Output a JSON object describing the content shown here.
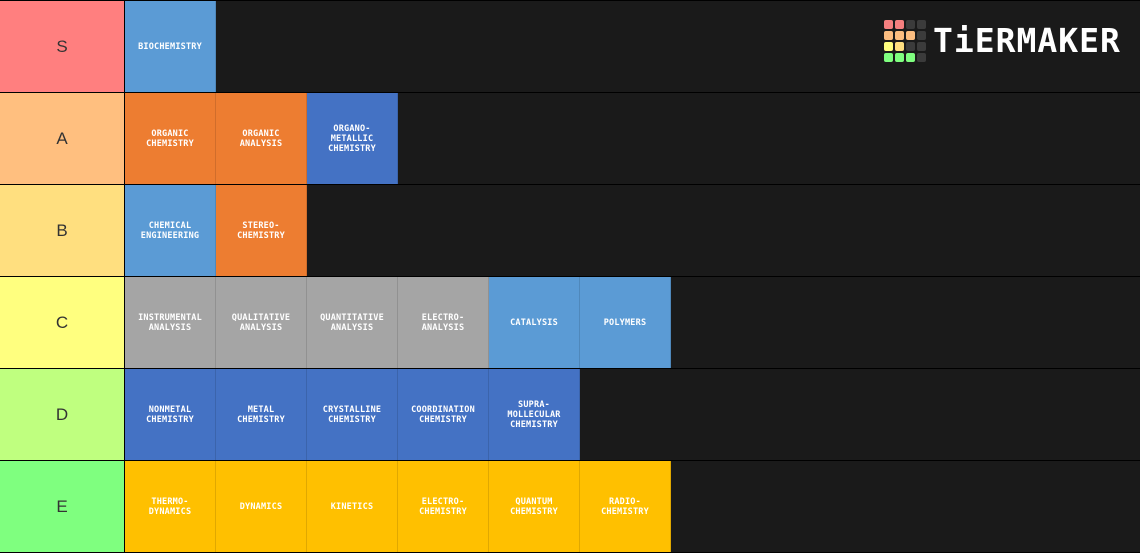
{
  "logo": {
    "text": "TiERMAKER",
    "grid_colors": [
      "#f57f7f",
      "#f57f7f",
      "#3b3b3b",
      "#3b3b3b",
      "#fbbd80",
      "#fbbd80",
      "#fbbd80",
      "#3b3b3b",
      "#ffff7f",
      "#ffdf80",
      "#3b3b3b",
      "#3b3b3b",
      "#7fff7f",
      "#7fff7f",
      "#7fff7f",
      "#3b3b3b"
    ]
  },
  "colors": {
    "light_blue": "#5b9bd5",
    "orange": "#ed7d31",
    "blue": "#4472c4",
    "gray": "#a5a5a5",
    "gold": "#ffc000",
    "row_background": "#1a1a1a"
  },
  "tiers": [
    {
      "label": "S",
      "color": "#ff7f7f",
      "items": [
        {
          "text": "BIOCHEMISTRY",
          "color": "#5b9bd5"
        }
      ]
    },
    {
      "label": "A",
      "color": "#ffbf7f",
      "items": [
        {
          "text": "ORGANIC\nCHEMISTRY",
          "color": "#ed7d31"
        },
        {
          "text": "ORGANIC\nANALYSIS",
          "color": "#ed7d31"
        },
        {
          "text": "ORGANO-\nMETALLIC\nCHEMISTRY",
          "color": "#4472c4"
        }
      ]
    },
    {
      "label": "B",
      "color": "#ffdf7f",
      "items": [
        {
          "text": "CHEMICAL\nENGINEERING",
          "color": "#5b9bd5"
        },
        {
          "text": "STEREO-\nCHEMISTRY",
          "color": "#ed7d31"
        }
      ]
    },
    {
      "label": "C",
      "color": "#ffff7f",
      "items": [
        {
          "text": "INSTRUMENTAL\nANALYSIS",
          "color": "#a5a5a5"
        },
        {
          "text": "QUALITATIVE\nANALYSIS",
          "color": "#a5a5a5"
        },
        {
          "text": "QUANTITATIVE\nANALYSIS",
          "color": "#a5a5a5"
        },
        {
          "text": "ELECTRO-\nANALYSIS",
          "color": "#a5a5a5"
        },
        {
          "text": "CATALYSIS",
          "color": "#5b9bd5"
        },
        {
          "text": "POLYMERS",
          "color": "#5b9bd5"
        }
      ]
    },
    {
      "label": "D",
      "color": "#bfff7f",
      "items": [
        {
          "text": "NONMETAL\nCHEMISTRY",
          "color": "#4472c4"
        },
        {
          "text": "METAL\nCHEMISTRY",
          "color": "#4472c4"
        },
        {
          "text": "CRYSTALLINE\nCHEMISTRY",
          "color": "#4472c4"
        },
        {
          "text": "COORDINATION\nCHEMISTRY",
          "color": "#4472c4"
        },
        {
          "text": "SUPRA-\nMOLLECULAR\nCHEMISTRY",
          "color": "#4472c4"
        }
      ]
    },
    {
      "label": "E",
      "color": "#7fff7f",
      "items": [
        {
          "text": "THERMO-\nDYNAMICS",
          "color": "#ffc000"
        },
        {
          "text": "DYNAMICS",
          "color": "#ffc000"
        },
        {
          "text": "KINETICS",
          "color": "#ffc000"
        },
        {
          "text": "ELECTRO-\nCHEMISTRY",
          "color": "#ffc000"
        },
        {
          "text": "QUANTUM\nCHEMISTRY",
          "color": "#ffc000"
        },
        {
          "text": "RADIO-\nCHEMISTRY",
          "color": "#ffc000"
        }
      ]
    }
  ]
}
